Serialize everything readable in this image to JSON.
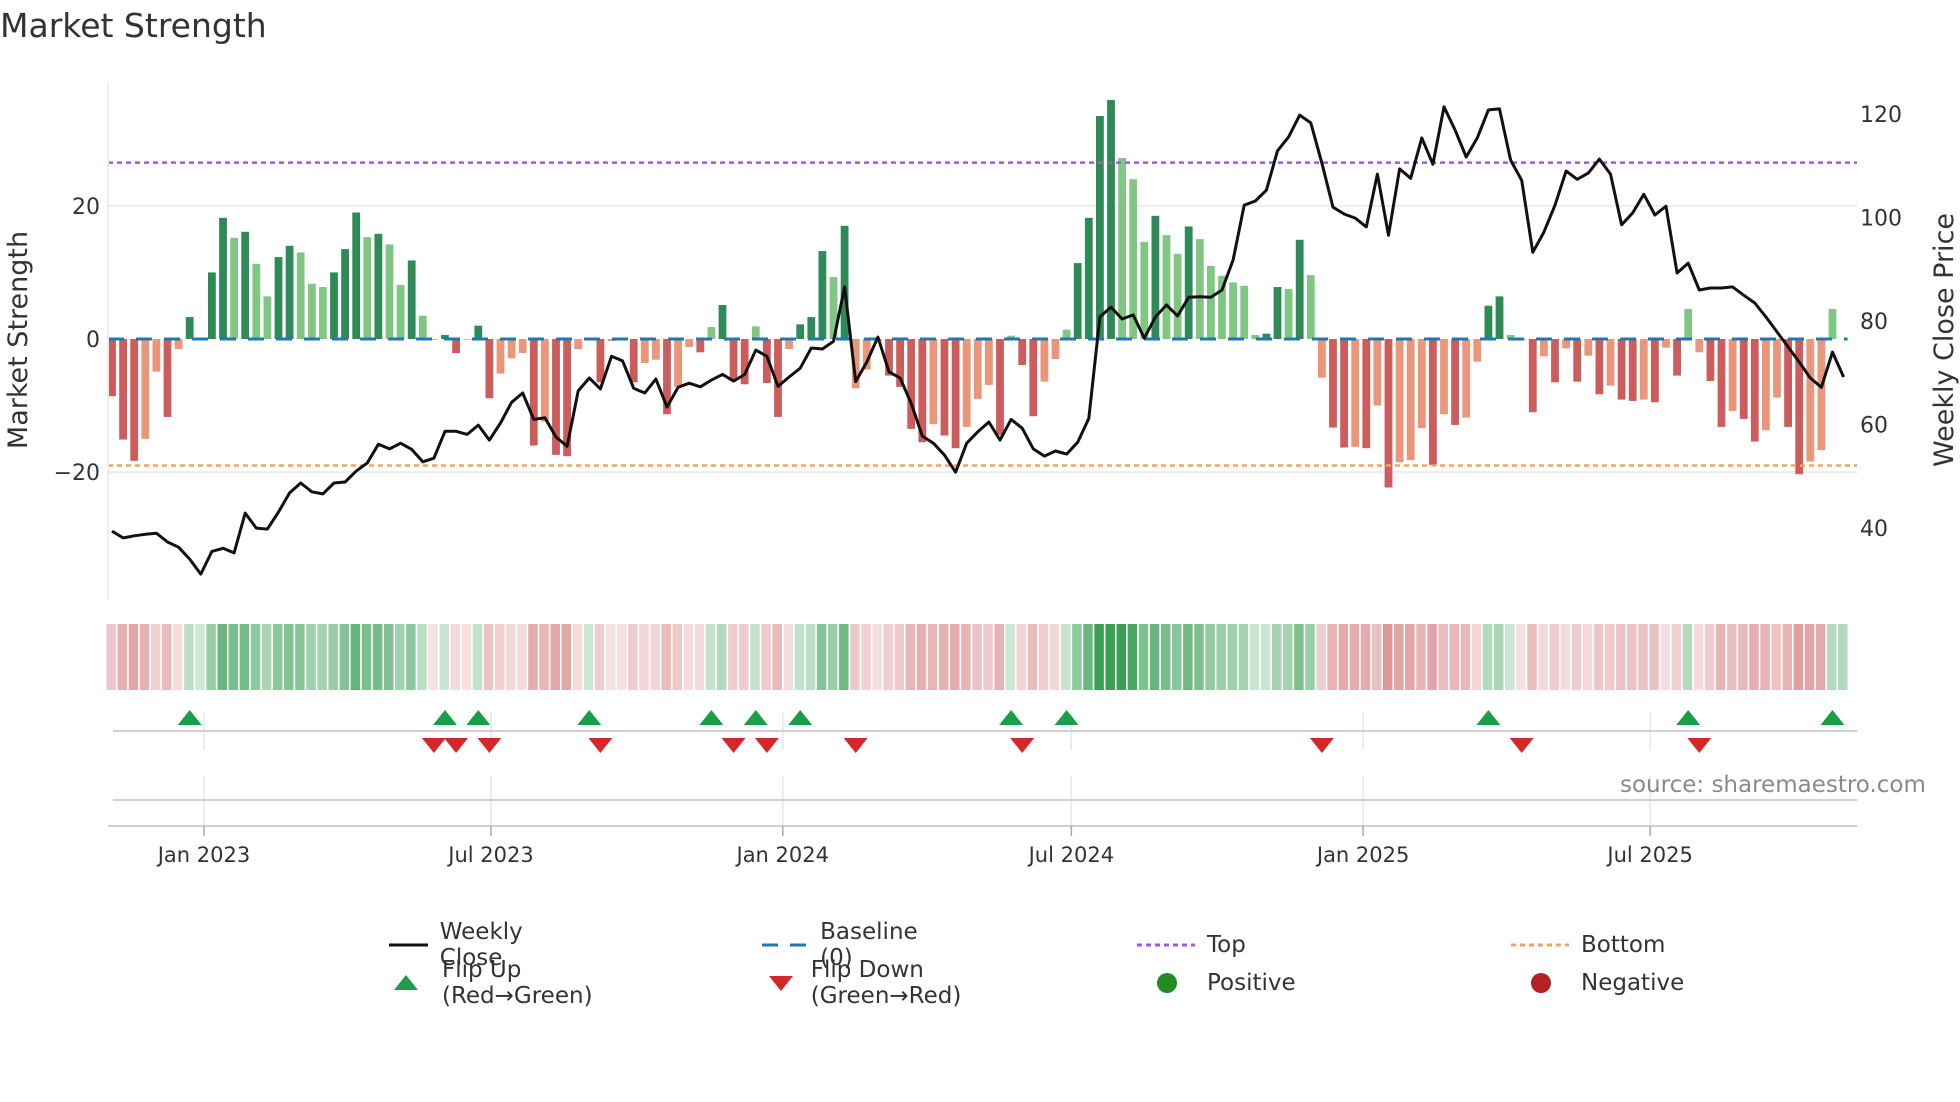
{
  "title": "Market Strength",
  "source": "source: sharemaestro.com",
  "colors": {
    "bar_pos_strong": "#2e8b57",
    "bar_pos_weak": "#81c784",
    "bar_neg_strong": "#cd5c5c",
    "bar_neg_weak": "#e9967a",
    "baseline": "#1f77b4",
    "top": "#9b59f0",
    "bottom": "#f4a460",
    "close": "#111111",
    "flip_up": "#1a9e47",
    "flip_down": "#d62728",
    "positive": "#228b22",
    "negative": "#b22222",
    "strip_pos": "#3a9f55",
    "strip_neg": "#d9888a"
  },
  "legend": [
    {
      "label": "Weekly Close",
      "marker": "line-solid-black"
    },
    {
      "label": "Baseline (0)",
      "marker": "line-dashed-blue"
    },
    {
      "label": "Top",
      "marker": "line-dotted-purple"
    },
    {
      "label": "Bottom",
      "marker": "line-dotted-orange"
    },
    {
      "label": "Flip Up (Red→Green)",
      "marker": "triangle-up-green"
    },
    {
      "label": "Flip Down (Green→Red)",
      "marker": "triangle-down-red"
    },
    {
      "label": "Positive",
      "marker": "circle-green"
    },
    {
      "label": "Negative",
      "marker": "circle-red"
    }
  ],
  "chart_data": {
    "type": "bar+line",
    "title": "Market Strength",
    "ylabel": "Market Strength",
    "y2label": "Weekly Close Price",
    "ylim": [
      -39.2,
      38.6
    ],
    "y2lim": [
      26.1,
      126.2
    ],
    "yticks": [
      20,
      0,
      -20
    ],
    "ytick_labels": [
      "20",
      "0",
      "−20"
    ],
    "y2ticks": [
      120,
      100,
      80,
      60,
      40
    ],
    "y2tick_labels": [
      "120",
      "100",
      "80",
      "60",
      "40"
    ],
    "top_level": 26.5,
    "bottom_level": -19,
    "baseline": 0,
    "x_start": "2022-11-04",
    "x_interval_days": 7,
    "xticks": [
      {
        "date": "2023-01-01",
        "label": "Jan 2023"
      },
      {
        "date": "2023-07-01",
        "label": "Jul 2023"
      },
      {
        "date": "2024-01-01",
        "label": "Jan 2024"
      },
      {
        "date": "2024-07-01",
        "label": "Jul 2024"
      },
      {
        "date": "2025-01-01",
        "label": "Jan 2025"
      },
      {
        "date": "2025-07-01",
        "label": "Jul 2025"
      }
    ],
    "strength": [
      -8.6,
      -15.1,
      -18.3,
      -15,
      -4.9,
      -11.7,
      -1.5,
      3.3,
      0.2,
      10,
      18.2,
      15.2,
      16.1,
      11.3,
      6.4,
      12.3,
      14,
      13,
      8.3,
      7.8,
      10,
      13.5,
      19,
      15.3,
      15.8,
      14.2,
      8.1,
      11.8,
      3.5,
      -0.1,
      0.6,
      -2.1,
      -0.1,
      2,
      -8.9,
      -5.2,
      -2.9,
      -2.1,
      -16,
      -12.4,
      -17.4,
      -17.6,
      -1.5,
      0.2,
      -6.5,
      -0.3,
      -0.2,
      -6.5,
      -3.6,
      -3.1,
      -11.3,
      -7.2,
      -1.2,
      -2,
      1.8,
      5.1,
      -6.1,
      -6.8,
      1.9,
      -6.6,
      -11.7,
      -1.5,
      2.2,
      3.3,
      13.2,
      9.3,
      17,
      -7.4,
      -4.6,
      -0.3,
      -5.5,
      -7.2,
      -13.5,
      -15.5,
      -12.8,
      -14.5,
      -16.4,
      -13.2,
      -9,
      -6.9,
      -14.4,
      0.5,
      -3.9,
      -11.6,
      -6.4,
      -3,
      1.4,
      11.4,
      18.2,
      33.5,
      35.9,
      27.2,
      24,
      14.6,
      18.5,
      15.6,
      12.8,
      16.9,
      15,
      11,
      9.5,
      8.5,
      8,
      0.6,
      0.8,
      7.8,
      7.5,
      14.9,
      9.6,
      -5.8,
      -13.3,
      -16.3,
      -16.2,
      -16.4,
      -10,
      -22.3,
      -18.5,
      -18.2,
      -13.4,
      -18.9,
      -11.3,
      -12.9,
      -11.8,
      -3.4,
      5,
      6.4,
      0.6,
      -0.2,
      -11,
      -2.6,
      -6.5,
      -1.4,
      -6.4,
      -2.5,
      -8.3,
      -7,
      -9.1,
      -9.3,
      -9.1,
      -9.5,
      -1.3,
      -5.5,
      4.5,
      -2,
      -6.3,
      -13.2,
      -10.8,
      -12,
      -15.4,
      -13.7,
      -8.8,
      -13.2,
      -20.3,
      -18.4,
      -16.7,
      4.5,
      null
    ],
    "weekly_close": [
      39.4,
      38.1,
      38.5,
      38.8,
      39.0,
      37.3,
      36.3,
      34.0,
      31.1,
      35.5,
      36.1,
      35.2,
      42.9,
      40.0,
      39.8,
      43.1,
      46.8,
      48.7,
      47.0,
      46.6,
      48.7,
      48.9,
      51.0,
      52.6,
      56.2,
      55.3,
      56.4,
      55.2,
      52.8,
      53.5,
      58.7,
      58.7,
      58.1,
      59.9,
      57.0,
      60.3,
      64.3,
      66.1,
      61.0,
      61.3,
      57.6,
      55.8,
      66.5,
      69.0,
      66.9,
      73.2,
      72.3,
      67.0,
      66.1,
      68.8,
      63.4,
      67.2,
      68.0,
      67.3,
      68.6,
      69.7,
      68.4,
      69.7,
      74.4,
      73.2,
      67.4,
      69.2,
      70.9,
      74.8,
      74.6,
      76.1,
      86.6,
      68.3,
      72.1,
      76.9,
      70.2,
      69.0,
      64.1,
      57.8,
      56.4,
      54.1,
      50.8,
      56.4,
      58.6,
      60.5,
      57.0,
      61.0,
      59.3,
      55.3,
      53.9,
      54.9,
      54.3,
      56.6,
      61.2,
      80.8,
      82.7,
      80.4,
      81.2,
      76.7,
      80.8,
      83.1,
      81.0,
      84.6,
      84.7,
      84.6,
      86.0,
      91.8,
      102.4,
      103.2,
      105.3,
      112.9,
      115.6,
      119.8,
      118.3,
      110.5,
      102.0,
      100.7,
      99.9,
      98.2,
      108.4,
      96.6,
      109.4,
      107.6,
      115.4,
      110.3,
      121.4,
      116.9,
      111.7,
      115.4,
      120.8,
      121.0,
      111.1,
      107.2,
      93.3,
      97.2,
      102.4,
      109.0,
      107.4,
      108.6,
      111.3,
      108.4,
      98.6,
      100.9,
      104.5,
      100.5,
      102.2,
      89.3,
      91.2,
      86.0,
      86.4,
      86.4,
      86.6,
      85.0,
      83.5,
      80.8,
      77.9,
      75.0,
      72.1,
      69.0,
      67.2,
      74.0,
      69.2
    ]
  }
}
